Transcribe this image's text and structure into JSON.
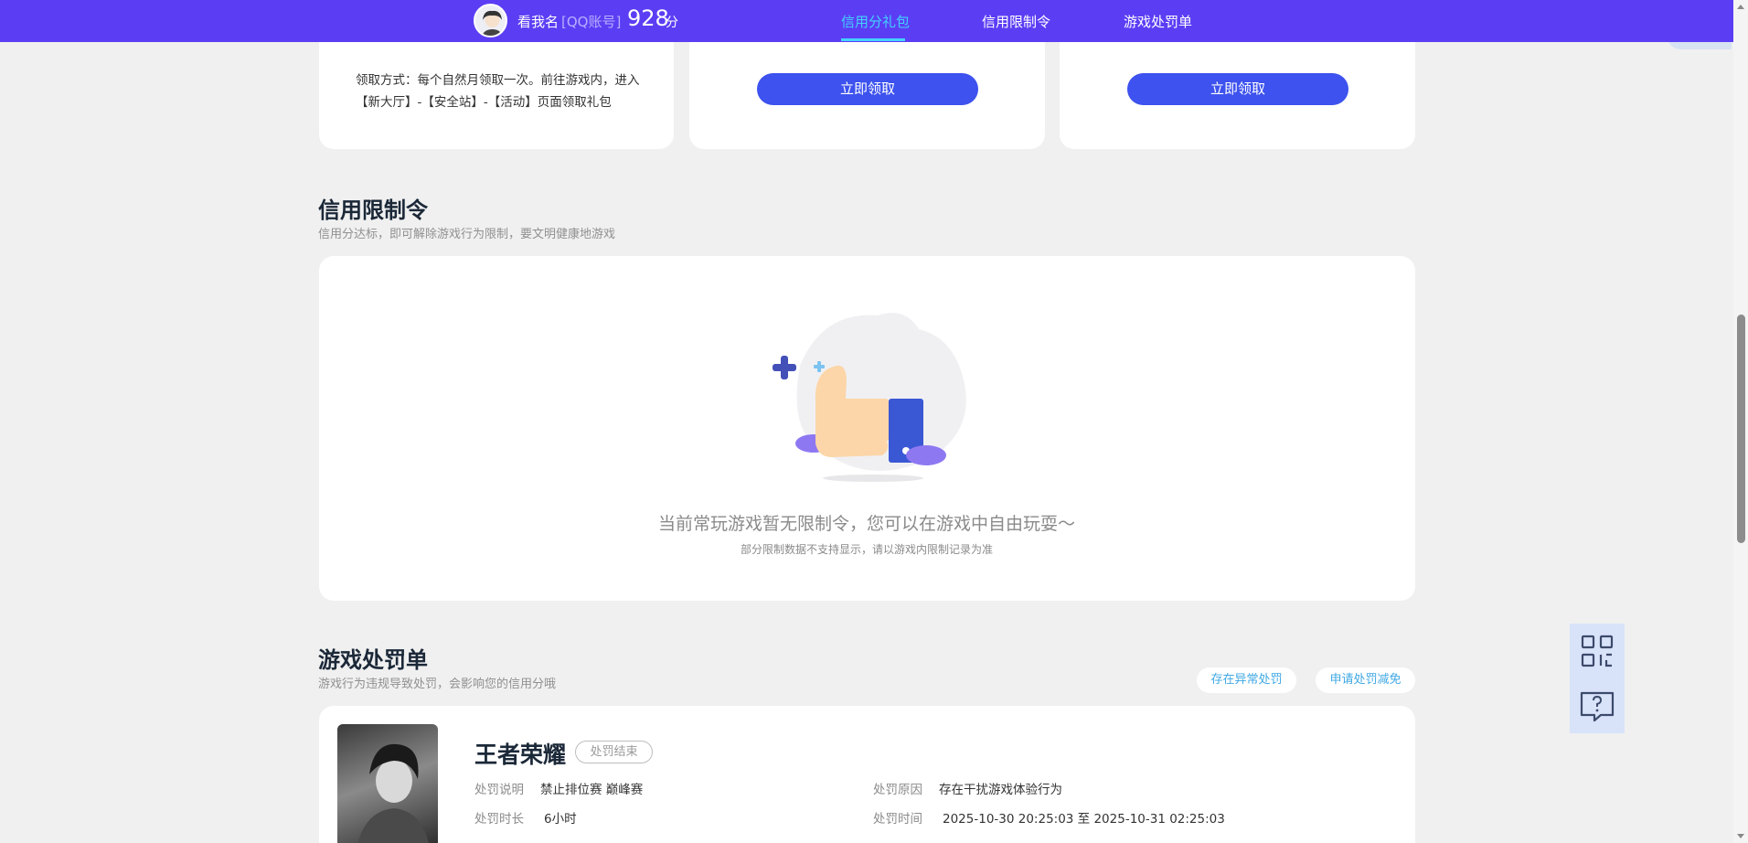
{
  "header": {
    "user_name": "看我名",
    "account_type": "[QQ账号]",
    "score": "928",
    "score_unit": "分",
    "nav": [
      {
        "label": "信用分礼包",
        "active": true
      },
      {
        "label": "信用限制令",
        "active": false
      },
      {
        "label": "游戏处罚单",
        "active": false
      }
    ]
  },
  "gift_cards": {
    "claim_method": "领取方式：每个自然月领取一次。前往游戏内，进入【新大厅】-【安全站】-【活动】页面领取礼包",
    "buttons": [
      "立即领取",
      "立即领取"
    ]
  },
  "restriction": {
    "title": "信用限制令",
    "subtitle": "信用分达标，即可解除游戏行为限制，要文明健康地游戏",
    "empty_text": "当前常玩游戏暂无限制令，您可以在游戏中自由玩耍～",
    "empty_note": "部分限制数据不支持显示，请以游戏内限制记录为准"
  },
  "penalty": {
    "title": "游戏处罚单",
    "subtitle": "游戏行为违规导致处罚，会影响您的信用分哦",
    "actions": [
      "存在异常处罚",
      "申请处罚减免"
    ],
    "item": {
      "game": "王者荣耀",
      "status": "处罚结束",
      "desc_label": "处罚说明",
      "desc_value": "禁止排位赛 巅峰赛",
      "reason_label": "处罚原因",
      "reason_value": "存在干扰游戏体验行为",
      "duration_label": "处罚时长",
      "duration_value": "6小时",
      "time_label": "处罚时间",
      "time_value": "2025-10-30 20:25:03 至 2025-10-31 02:25:03"
    }
  },
  "colors": {
    "header_bg": "#5b3ef4",
    "nav_active": "#43d2ff",
    "primary_button": "#3d52ee",
    "link": "#3fa8e4"
  },
  "icons": {
    "qr": "qr-code-icon",
    "feedback": "question-chat-icon",
    "empty": "thumbs-up-illustration"
  }
}
